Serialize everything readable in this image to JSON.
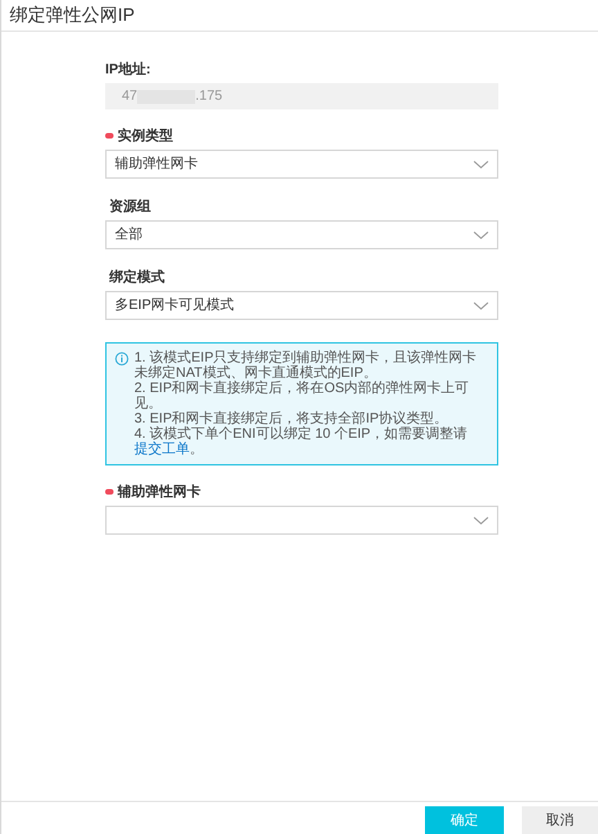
{
  "dialog": {
    "title": "绑定弹性公网IP"
  },
  "ip_field": {
    "label": "IP地址:",
    "value_prefix": "47",
    "value_suffix": ".175"
  },
  "fields_before_note": [
    {
      "label": "实例类型",
      "required": true,
      "value": "辅助弹性网卡"
    },
    {
      "label": "资源组",
      "required": false,
      "value": "全部"
    },
    {
      "label": "绑定模式",
      "required": false,
      "value": "多EIP网卡可见模式"
    }
  ],
  "note": {
    "lines": [
      {
        "text": "1. 该模式EIP只支持绑定到辅助弹性网卡，且该弹性网卡未绑定NAT模式、网卡直通模式的EIP。"
      },
      {
        "text": "2. EIP和网卡直接绑定后，将在OS内部的弹性网卡上可见。"
      },
      {
        "text": "3. EIP和网卡直接绑定后，将支持全部IP协议类型。"
      },
      {
        "text": "4. 该模式下单个ENI可以绑定 10 个EIP，如需要调整请",
        "link": "提交工单",
        "after": "。"
      }
    ]
  },
  "fields_after_note": [
    {
      "label": "辅助弹性网卡",
      "required": true
    }
  ],
  "buttons": [
    {
      "label": "确定",
      "kind": "primary"
    },
    {
      "label": "取消",
      "kind": "secondary"
    }
  ]
}
